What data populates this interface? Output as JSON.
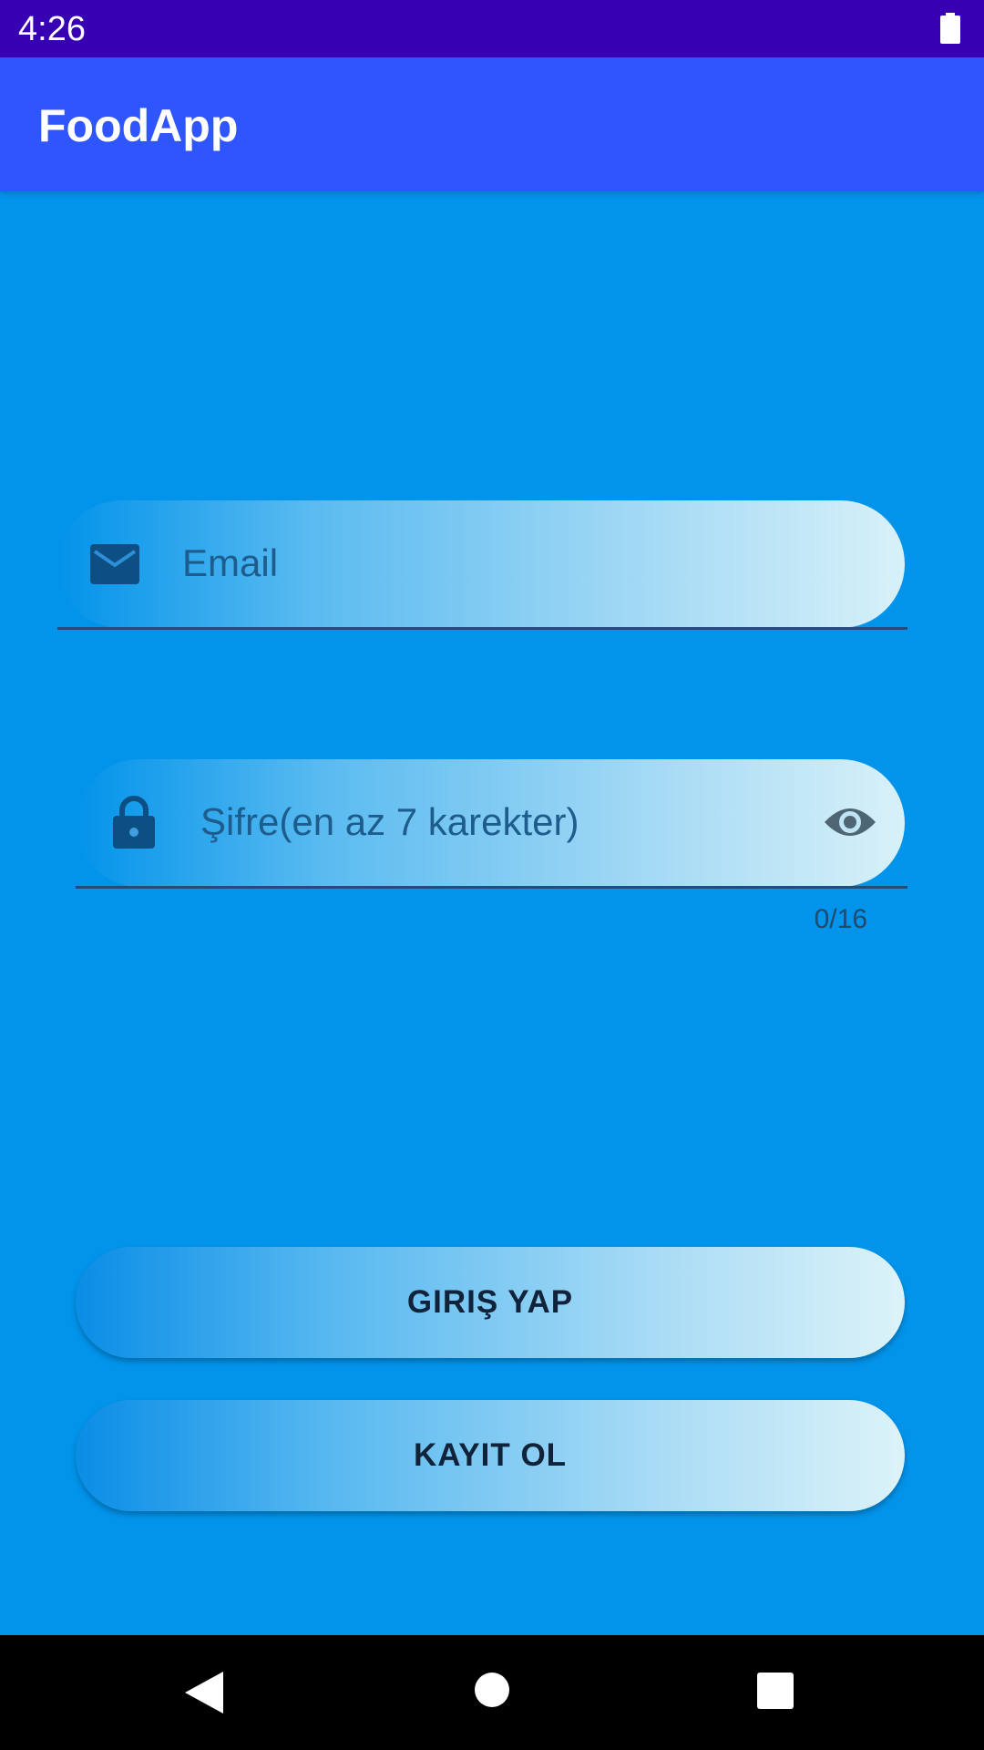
{
  "status_bar": {
    "time": "4:26",
    "battery_icon": "battery-full-icon"
  },
  "app_bar": {
    "title": "FoodApp"
  },
  "form": {
    "email": {
      "icon": "mail-icon",
      "placeholder": "Email"
    },
    "password": {
      "icon": "lock-icon",
      "placeholder": "Şifre(en az 7 karekter)",
      "toggle_icon": "eye-icon",
      "counter": "0/16"
    }
  },
  "buttons": {
    "login_label": "GIRIŞ YAP",
    "register_label": "KAYIT OL"
  },
  "nav_bar": {
    "back_icon": "back-icon",
    "home_icon": "home-icon",
    "recents_icon": "recents-icon"
  },
  "colors": {
    "status_bar": "#3700B3",
    "app_bar": "#2F55FF",
    "background": "#0293EA",
    "nav_bar": "#000000"
  }
}
